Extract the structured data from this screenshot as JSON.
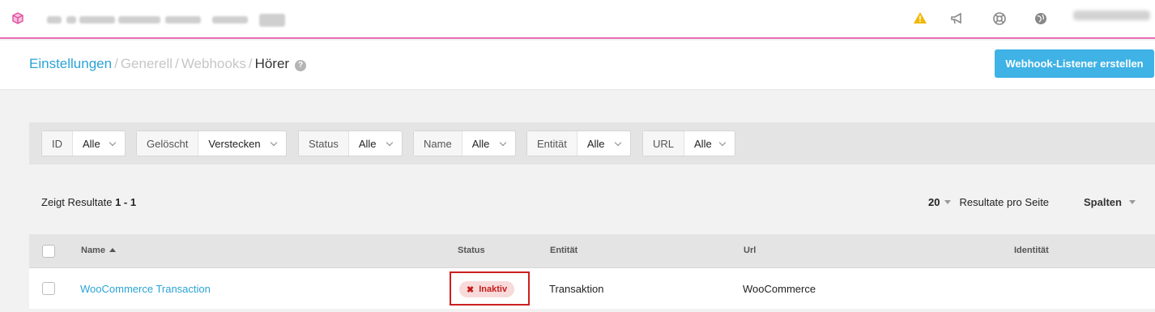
{
  "header": {
    "breadcrumb": [
      "Einstellungen",
      "Generell",
      "Webhooks",
      "Hörer"
    ],
    "separator": "/",
    "help_icon": "?",
    "create_button": "Webhook-Listener erstellen"
  },
  "topbar": {
    "icons": [
      "cube-logo-icon",
      "warning-icon",
      "megaphone-icon",
      "lifebuoy-icon",
      "globe-icon"
    ]
  },
  "filters": [
    {
      "label": "ID",
      "value": "Alle"
    },
    {
      "label": "Gelöscht",
      "value": "Verstecken"
    },
    {
      "label": "Status",
      "value": "Alle"
    },
    {
      "label": "Name",
      "value": "Alle"
    },
    {
      "label": "Entität",
      "value": "Alle"
    },
    {
      "label": "URL",
      "value": "Alle"
    }
  ],
  "results": {
    "prefix": "Zeigt Resultate",
    "range": "1 - 1",
    "per_page_value": "20",
    "per_page_label": "Resultate pro Seite",
    "columns_label": "Spalten"
  },
  "table": {
    "columns": [
      "Name",
      "Status",
      "Entität",
      "Url",
      "Identität"
    ],
    "rows": [
      {
        "name": "WooCommerce Transaction",
        "status": "Inaktiv",
        "entity": "Transaktion",
        "url": "WooCommerce",
        "identity": ""
      }
    ]
  },
  "colors": {
    "accent": "#3fb2e6",
    "link": "#2ba3d6",
    "topbar_border": "#e86fb0",
    "inactive_text": "#c51c1c",
    "inactive_bg": "#f8dada",
    "highlight_outline": "#cc1f1f",
    "warning": "#f2b705"
  }
}
